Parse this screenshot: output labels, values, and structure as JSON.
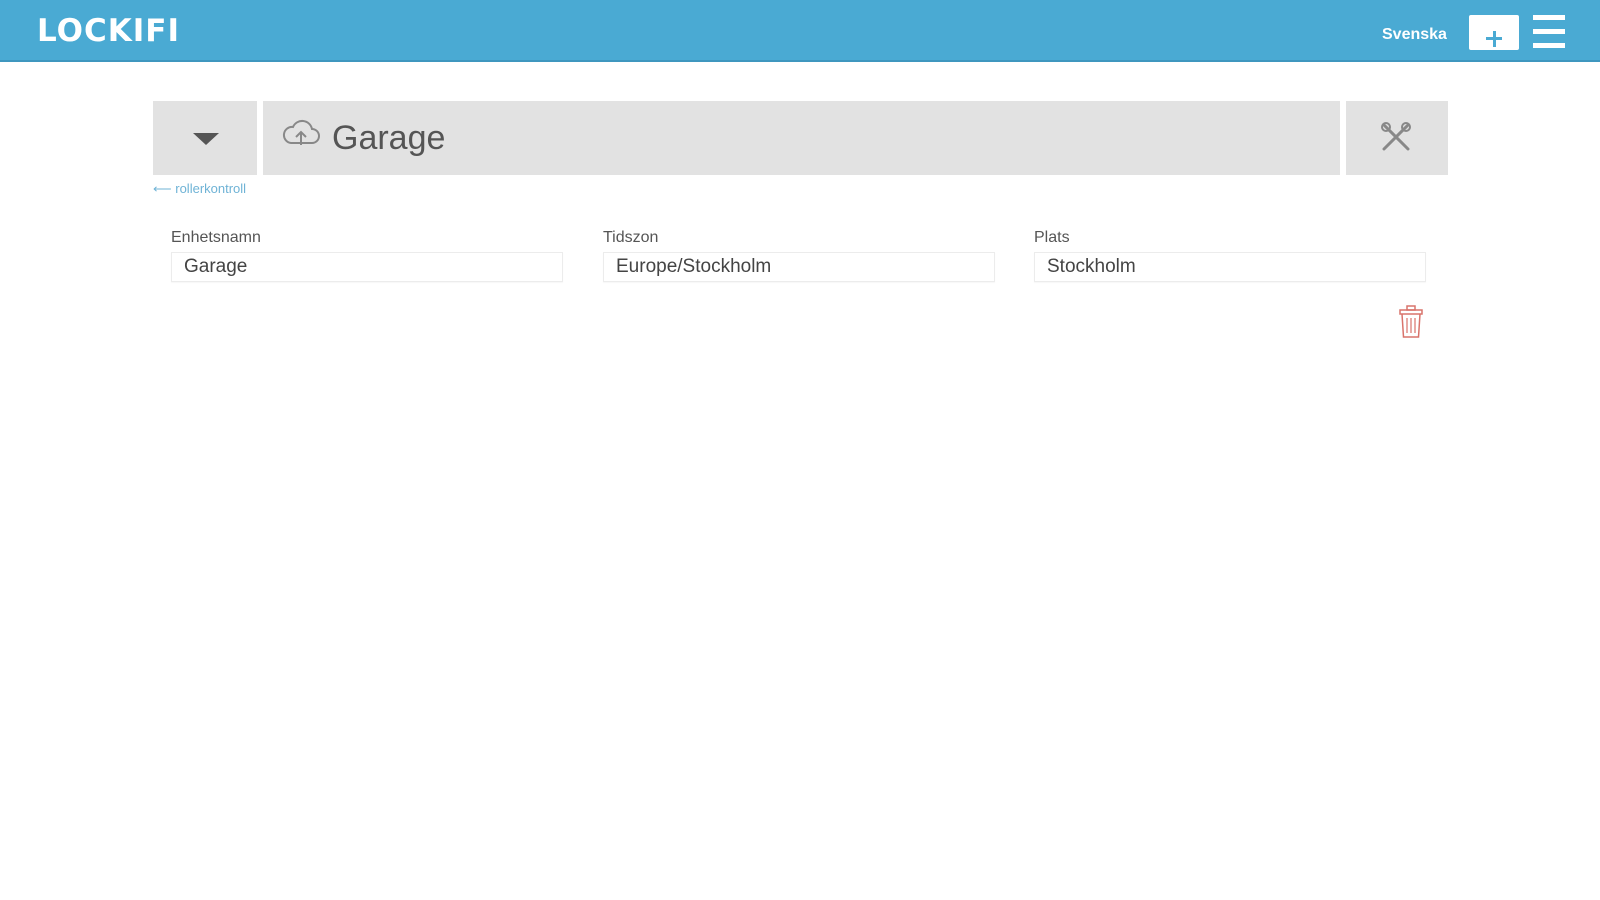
{
  "header": {
    "logo": "LOCKIFI",
    "language": "Svenska",
    "add_icon": "plus-icon",
    "menu_icon": "hamburger-menu-icon",
    "background_color": "#4aaad3"
  },
  "device": {
    "toggle_icon": "caret-down-icon",
    "status_icon": "cloud-upload-icon",
    "title": "Garage",
    "settings_icon": "tools-icon"
  },
  "back_link": "⟵ rollerkontroll",
  "fields": {
    "name": {
      "label": "Enhetsnamn",
      "value": "Garage"
    },
    "timezone": {
      "label": "Tidszon",
      "value": "Europe/Stockholm"
    },
    "location": {
      "label": "Plats",
      "value": "Stockholm"
    }
  },
  "delete_icon": "trash-icon",
  "delete_icon_color": "#d9736b"
}
